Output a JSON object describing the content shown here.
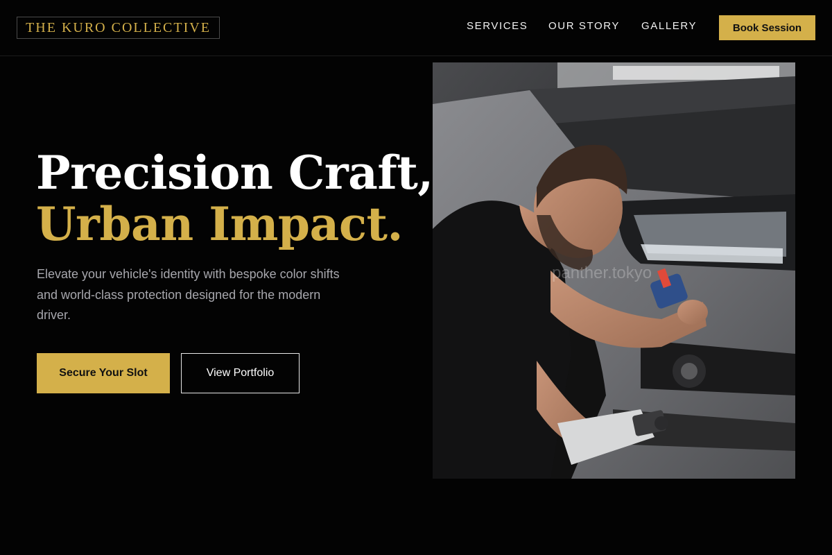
{
  "header": {
    "brand": "THE KURO COLLECTIVE",
    "nav": [
      "SERVICES",
      "OUR STORY",
      "GALLERY"
    ],
    "cta_label": "Book Session"
  },
  "hero": {
    "headline_line1": "Precision Craft,",
    "headline_line2": "Urban Impact.",
    "subtext": "Elevate your vehicle's identity with bespoke color shifts and world-class protection designed for the modern driver.",
    "primary_button": "Secure Your Slot",
    "secondary_button": "View Portfolio",
    "image_watermark": "panther.tokyo"
  },
  "colors": {
    "background": "#030303",
    "accent_gold": "#d4b04a",
    "text_light": "#ffffff",
    "text_muted": "#a7a7ad"
  }
}
